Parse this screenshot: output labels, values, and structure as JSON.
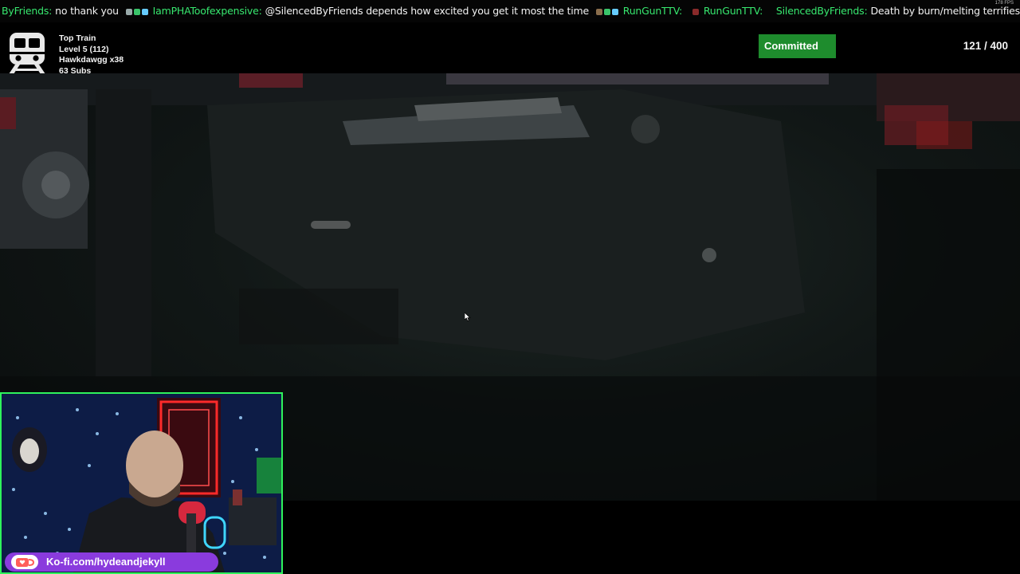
{
  "chat": {
    "messages": [
      {
        "user": "ByFriends:",
        "text": "no thank you",
        "badges": [
          "#9aa",
          "#3ac46a",
          "#6cf"
        ]
      },
      {
        "user": "IamPHAToofexpensive:",
        "text": "@SilencedByFriends depends how excited you get it most the time",
        "badges": [
          "#9aa",
          "#3ac46a",
          "#6cf"
        ]
      },
      {
        "user": "RunGunTTV:",
        "text": "",
        "badges": [
          "#8a6d4c",
          "#3ac46a",
          "#6cf"
        ]
      },
      {
        "user": "RunGunTTV:",
        "text": "",
        "badges": [
          "#8a2a2a"
        ]
      },
      {
        "user": "SilencedByFriends:",
        "text": "Death by burn/melting terrifies me",
        "badges": []
      }
    ],
    "fps": "178 FPS"
  },
  "train": {
    "title": "Top Train",
    "level": "Level 5  (112)",
    "top_user": "Hawkdawgg x38",
    "subs": "63 Subs",
    "committed_label": "Committed",
    "progress_text": "121 / 400",
    "progress_fraction": 0.3025,
    "accent": "#1e8c2d",
    "icon": "train-icon"
  },
  "webcam": {
    "border_color": "#2ef25c"
  },
  "kofi": {
    "label": "Ko-fi.com/hydeandjekyll",
    "bar_color": "#8a3bdd",
    "icon": "kofi-cup-icon"
  }
}
